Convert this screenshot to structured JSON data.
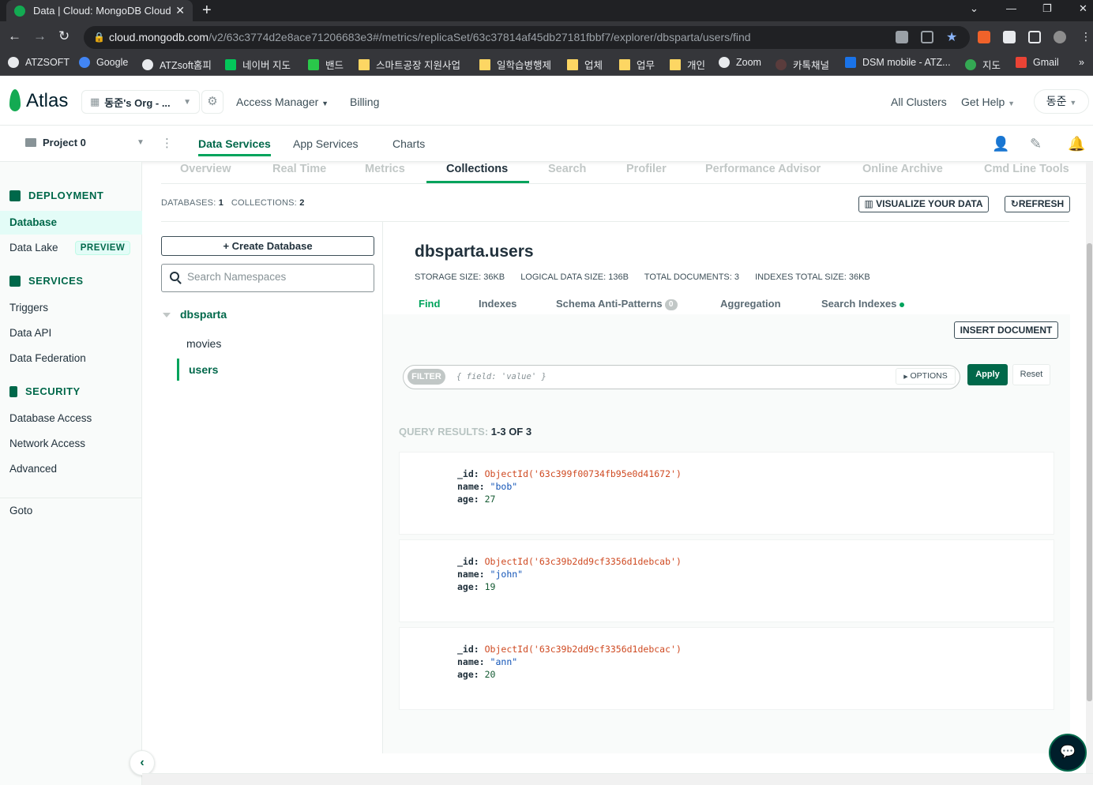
{
  "browser": {
    "tab_title": "Data | Cloud: MongoDB Cloud",
    "tab_close": "✕",
    "new_tab": "+",
    "window_controls": [
      "⌄",
      "—",
      "❐",
      "✕"
    ],
    "url_host": "cloud.mongodb.com",
    "url_path": "/v2/63c3774d2e8ace71206683e3#/metrics/replicaSet/63c37814af45db27181fbbf7/explorer/dbsparta/users/find",
    "bookmarks": [
      "ATZSOFT",
      "Google",
      "ATZsoft홈피",
      "네이버 지도",
      "밴드",
      "스마트공장 지원사업",
      "일학습병행제",
      "업체",
      "업무",
      "개인",
      "Zoom",
      "카톡채널",
      "DSM mobile - ATZ...",
      "지도",
      "Gmail"
    ],
    "bookmarks_more": "»"
  },
  "header": {
    "logo_text": "Atlas",
    "org_name": "동준's Org - ...",
    "access_manager": "Access Manager",
    "billing": "Billing",
    "all_clusters": "All Clusters",
    "get_help": "Get Help",
    "user": "동준"
  },
  "project_bar": {
    "project": "Project 0",
    "tabs": [
      "Data Services",
      "App Services",
      "Charts"
    ]
  },
  "sidebar": {
    "deployment": "DEPLOYMENT",
    "database": "Database",
    "data_lake": "Data Lake",
    "preview": "PREVIEW",
    "services": "SERVICES",
    "triggers": "Triggers",
    "data_api": "Data API",
    "data_federation": "Data Federation",
    "security": "SECURITY",
    "database_access": "Database Access",
    "network_access": "Network Access",
    "advanced": "Advanced",
    "goto": "Goto"
  },
  "metric_tabs": [
    "Overview",
    "Real Time",
    "Metrics",
    "Collections",
    "Search",
    "Profiler",
    "Performance Advisor",
    "Online Archive",
    "Cmd Line Tools"
  ],
  "counts": {
    "databases_label": "DATABASES:",
    "databases": "1",
    "collections_label": "COLLECTIONS:",
    "collections": "2"
  },
  "actions": {
    "visualize": "VISUALIZE YOUR DATA",
    "refresh": "REFRESH"
  },
  "namespaces": {
    "create_db": "Create Database",
    "search_placeholder": "Search Namespaces",
    "database": "dbsparta",
    "collections": [
      "movies",
      "users"
    ]
  },
  "collection": {
    "title": "dbsparta.users",
    "storage_size": "STORAGE SIZE: 36KB",
    "logical_size": "LOGICAL DATA SIZE: 136B",
    "total_docs": "TOTAL DOCUMENTS: 3",
    "indexes_size": "INDEXES TOTAL SIZE: 36KB",
    "tabs": [
      "Find",
      "Indexes",
      "Schema Anti-Patterns",
      "Aggregation",
      "Search Indexes"
    ],
    "anti_patterns_count": "0",
    "insert_document": "INSERT DOCUMENT",
    "filter_label": "FILTER",
    "filter_placeholder": "{ field: 'value' }",
    "options": "OPTIONS",
    "apply": "Apply",
    "reset": "Reset",
    "query_results_label": "QUERY RESULTS:",
    "query_results_range": "1-3 OF 3"
  },
  "documents": [
    {
      "id": "ObjectId('63c399f00734fb95e0d41672')",
      "name": "\"bob\"",
      "age": "27"
    },
    {
      "id": "ObjectId('63c39b2dd9cf3356d1debcab')",
      "name": "\"john\"",
      "age": "19"
    },
    {
      "id": "ObjectId('63c39b2dd9cf3356d1debcac')",
      "name": "\"ann\"",
      "age": "20"
    }
  ],
  "colors": {
    "brand_green": "#00684a",
    "accent_green": "#00a35c",
    "objectid_color": "#cf4a22",
    "string_color": "#1254b7"
  }
}
